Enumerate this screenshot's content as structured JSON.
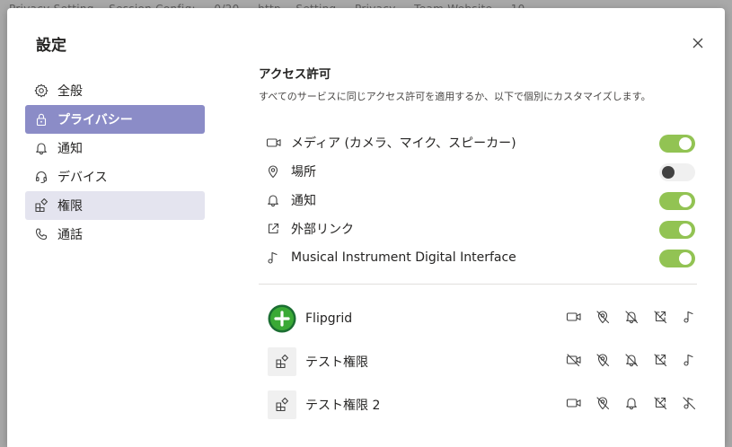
{
  "background_text": "Privacy Setting... Session Config: ... 0/20 ... http... Setting ... Privacy ... Team Website ... 10 ...",
  "dialog": {
    "title": "設定"
  },
  "sidebar": {
    "items": [
      {
        "label": "全般",
        "icon": "gear-icon",
        "state": "normal"
      },
      {
        "label": "プライバシー",
        "icon": "lock-icon",
        "state": "active"
      },
      {
        "label": "通知",
        "icon": "bell-icon",
        "state": "normal"
      },
      {
        "label": "デバイス",
        "icon": "headset-icon",
        "state": "normal"
      },
      {
        "label": "権限",
        "icon": "apps-icon",
        "state": "hover"
      },
      {
        "label": "通話",
        "icon": "phone-icon",
        "state": "normal"
      }
    ]
  },
  "permissions": {
    "title": "アクセス許可",
    "description": "すべてのサービスに同じアクセス許可を適用するか、以下で個別にカスタマイズします。",
    "items": [
      {
        "label": "メディア (カメラ、マイク、スピーカー)",
        "icon": "camera-icon",
        "enabled": true
      },
      {
        "label": "場所",
        "icon": "location-icon",
        "enabled": false
      },
      {
        "label": "通知",
        "icon": "bell-icon",
        "enabled": true
      },
      {
        "label": "外部リンク",
        "icon": "external-link-icon",
        "enabled": true
      },
      {
        "label": "Musical Instrument Digital Interface",
        "icon": "music-note-icon",
        "enabled": true
      }
    ]
  },
  "apps": [
    {
      "name": "Flipgrid",
      "icon": "flipgrid-logo-icon",
      "media": true,
      "location": false,
      "notifications": false,
      "links": false,
      "midi": true
    },
    {
      "name": "テスト権限",
      "icon": "app-generic-icon",
      "media": false,
      "location": false,
      "notifications": false,
      "links": false,
      "midi": true
    },
    {
      "name": "テスト権限 2",
      "icon": "app-generic-icon",
      "media": true,
      "location": false,
      "notifications": true,
      "links": false,
      "midi": false
    }
  ],
  "colors": {
    "accent": "#8b8cc7",
    "toggle_on": "#92c353",
    "hover": "#e4e4ef",
    "flipgrid_green": "#3aa935"
  }
}
